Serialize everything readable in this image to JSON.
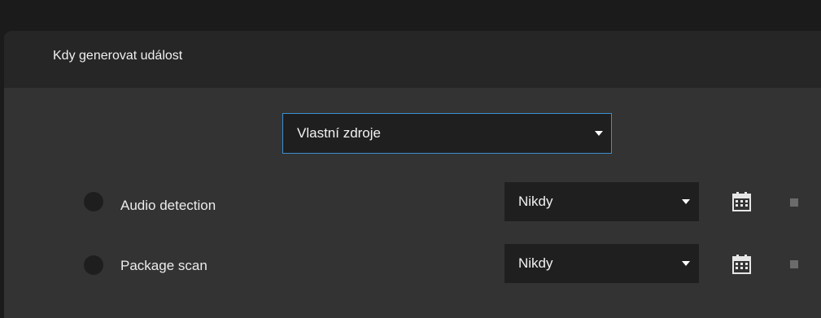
{
  "panel": {
    "title": "Kdy generovat událost"
  },
  "source_dropdown": {
    "value": "Vlastní zdroje",
    "icon": "chevron-down-icon"
  },
  "rows": [
    {
      "label": "Audio detection",
      "schedule": "Nikdy"
    },
    {
      "label": "Package scan",
      "schedule": "Nikdy"
    }
  ],
  "icons": {
    "calendar": "calendar-icon",
    "square": "square-toggle"
  },
  "colors": {
    "accent": "#3d8fd0",
    "panel_bg": "#333333",
    "header_bg": "#262626",
    "control_bg": "#1f1f1f"
  }
}
